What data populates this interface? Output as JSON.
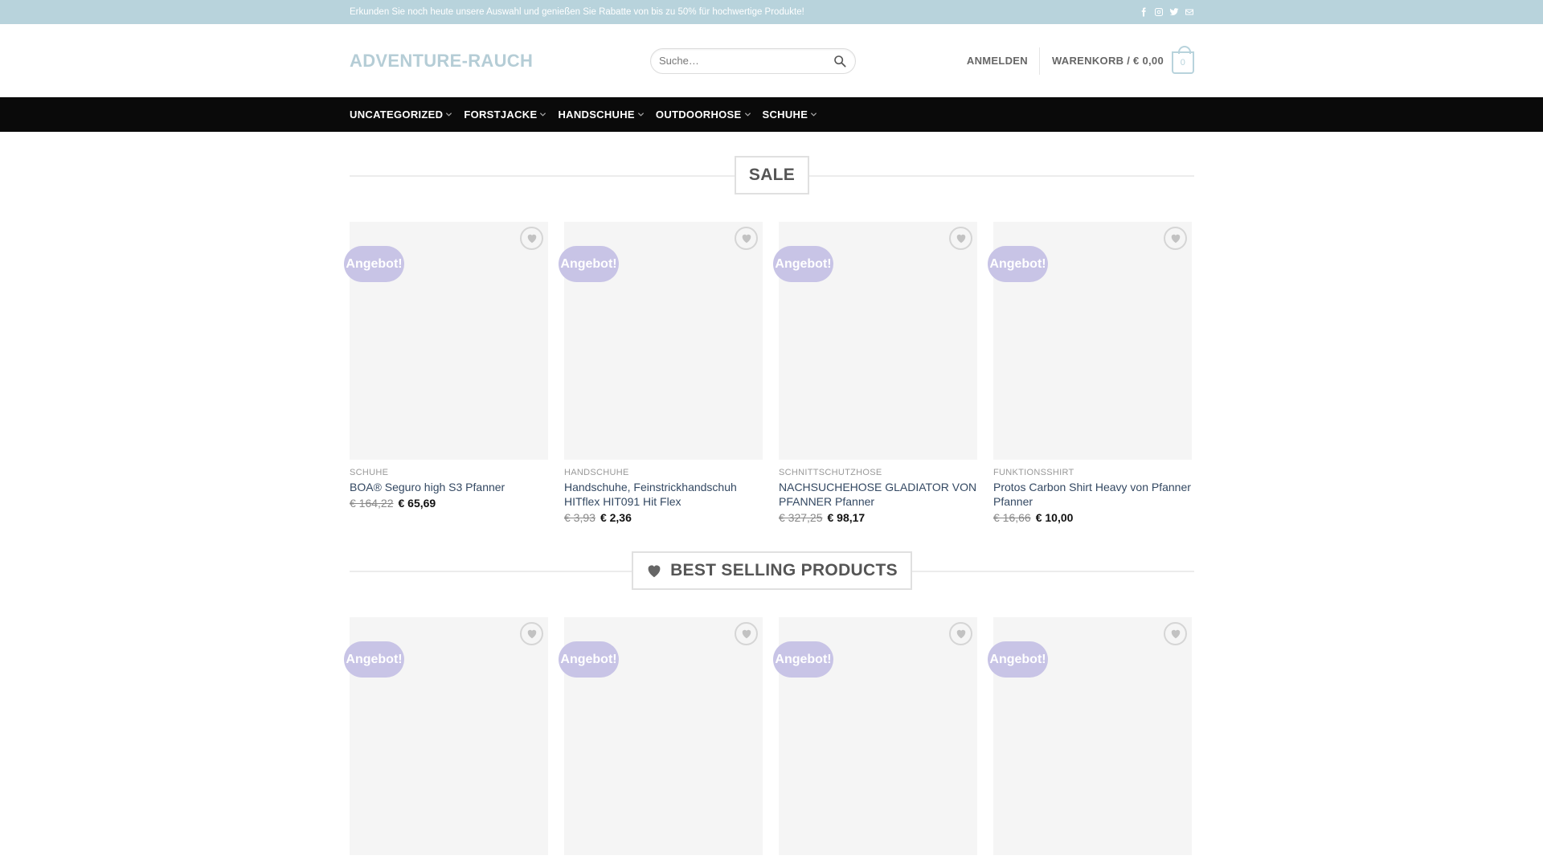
{
  "topbar": {
    "text": "Erkunden Sie noch heute unsere Auswahl und genießen Sie Rabatte von bis zu 50% für hochwertige Produkte!",
    "social": [
      "facebook-icon",
      "instagram-icon",
      "twitter-icon",
      "email-icon"
    ]
  },
  "header": {
    "logo": "ADVENTURE-RAUCH",
    "search_placeholder": "Suche…",
    "login": "ANMELDEN",
    "cart_label": "WARENKORB / € 0,00",
    "cart_count": "0"
  },
  "nav": {
    "items": [
      {
        "label": "UNCATEGORIZED"
      },
      {
        "label": "FORSTJACKE"
      },
      {
        "label": "HANDSCHUHE"
      },
      {
        "label": "OUTDOORHOSE"
      },
      {
        "label": "SCHUHE"
      }
    ]
  },
  "sections": {
    "sale": {
      "title": "SALE",
      "products": [
        {
          "badge": "Angebot!",
          "category": "SCHUHE",
          "name": "BOA® Seguro high S3 Pfanner",
          "old_price": "€ 164,22",
          "new_price": "€ 65,69"
        },
        {
          "badge": "Angebot!",
          "category": "HANDSCHUHE",
          "name": "Handschuhe, Feinstrickhandschuh HITflex HIT091 Hit Flex",
          "old_price": "€ 3,93",
          "new_price": "€ 2,36"
        },
        {
          "badge": "Angebot!",
          "category": "SCHNITTSCHUTZHOSE",
          "name": "NACHSUCHEHOSE GLADIATOR VON PFANNER Pfanner",
          "old_price": "€ 327,25",
          "new_price": "€ 98,17"
        },
        {
          "badge": "Angebot!",
          "category": "FUNKTIONSSHIRT",
          "name": "Protos Carbon Shirt Heavy von Pfanner Pfanner",
          "old_price": "€ 16,66",
          "new_price": "€ 10,00"
        }
      ]
    },
    "best": {
      "title": "BEST SELLING PRODUCTS",
      "products": [
        {
          "badge": "Angebot!"
        },
        {
          "badge": "Angebot!"
        },
        {
          "badge": "Angebot!"
        },
        {
          "badge": "Angebot!"
        }
      ]
    }
  },
  "colors": {
    "topbar": "#b8d3dc",
    "nav": "#0a0a0a",
    "badge": "#c8c4e6",
    "logo": "#b5cdd6",
    "product_name": "#334862"
  }
}
